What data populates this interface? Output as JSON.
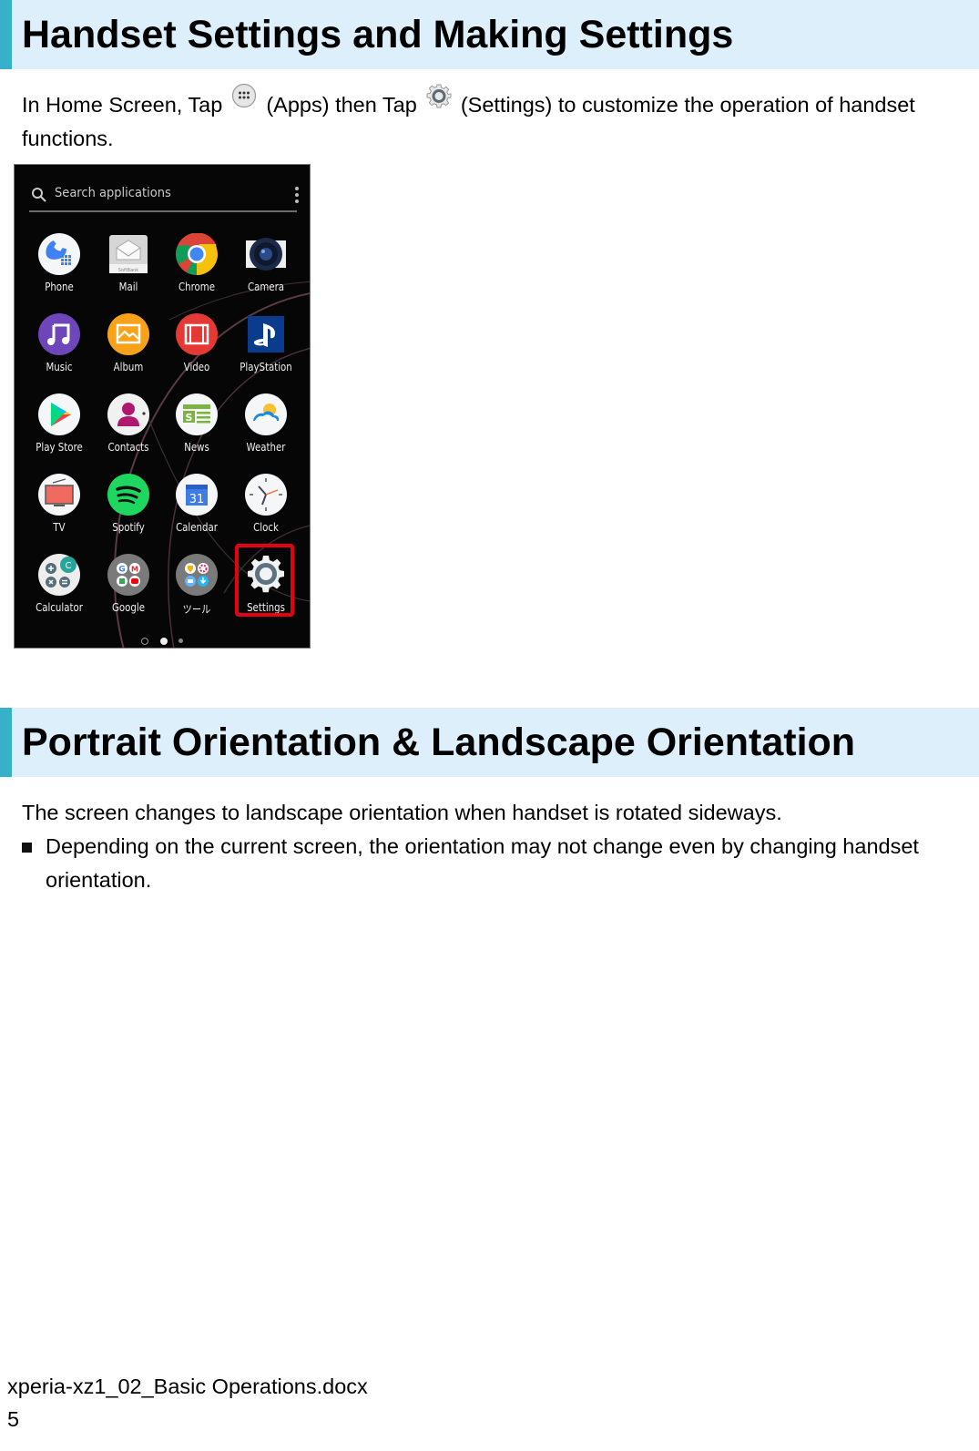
{
  "section1": {
    "heading": "Handset Settings and Making Settings",
    "intro_parts": [
      "In Home Screen, Tap",
      "(Apps) then Tap",
      "(Settings) to customize the operation of handset"
    ],
    "intro_line2": "functions.",
    "inline_icons": [
      "apps-icon",
      "settings-icon"
    ]
  },
  "phone_screen": {
    "search_placeholder": "Search applications",
    "apps": [
      {
        "label": "Phone",
        "icon": "phone-icon"
      },
      {
        "label": "Mail",
        "icon": "mail-icon"
      },
      {
        "label": "Chrome",
        "icon": "chrome-icon"
      },
      {
        "label": "Camera",
        "icon": "camera-icon"
      },
      {
        "label": "Music",
        "icon": "music-icon"
      },
      {
        "label": "Album",
        "icon": "album-icon"
      },
      {
        "label": "Video",
        "icon": "video-icon"
      },
      {
        "label": "PlayStation",
        "icon": "playstation-icon"
      },
      {
        "label": "Play Store",
        "icon": "play-store-icon"
      },
      {
        "label": "Contacts",
        "icon": "contacts-icon"
      },
      {
        "label": "News",
        "icon": "news-icon"
      },
      {
        "label": "Weather",
        "icon": "weather-icon"
      },
      {
        "label": "TV",
        "icon": "tv-icon"
      },
      {
        "label": "Spotify",
        "icon": "spotify-icon"
      },
      {
        "label": "Calendar",
        "icon": "calendar-icon"
      },
      {
        "label": "Clock",
        "icon": "clock-icon"
      },
      {
        "label": "Calculator",
        "icon": "calculator-icon"
      },
      {
        "label": "Google",
        "icon": "google-folder-icon"
      },
      {
        "label": "ツール",
        "icon": "tools-folder-icon"
      },
      {
        "label": "Settings",
        "icon": "settings-icon",
        "highlighted": true
      }
    ],
    "mail_brand": "SoftBank",
    "calendar_day": "31",
    "calc_badge": "C",
    "page_indicator": {
      "pages": 2,
      "current": 1
    }
  },
  "section2": {
    "heading": "Portrait Orientation & Landscape Orientation",
    "body": "The screen changes to landscape orientation when handset is rotated sideways.",
    "note_line1": "Depending on the current screen, the orientation may not change even by changing handset",
    "note_line2": "orientation."
  },
  "footer": {
    "filename": "xperia-xz1_02_Basic Operations.docx",
    "page_number": "5"
  },
  "colors": {
    "heading_bg": "#dceffa",
    "heading_accent": "#36b1c9",
    "highlight": "#e60012"
  }
}
